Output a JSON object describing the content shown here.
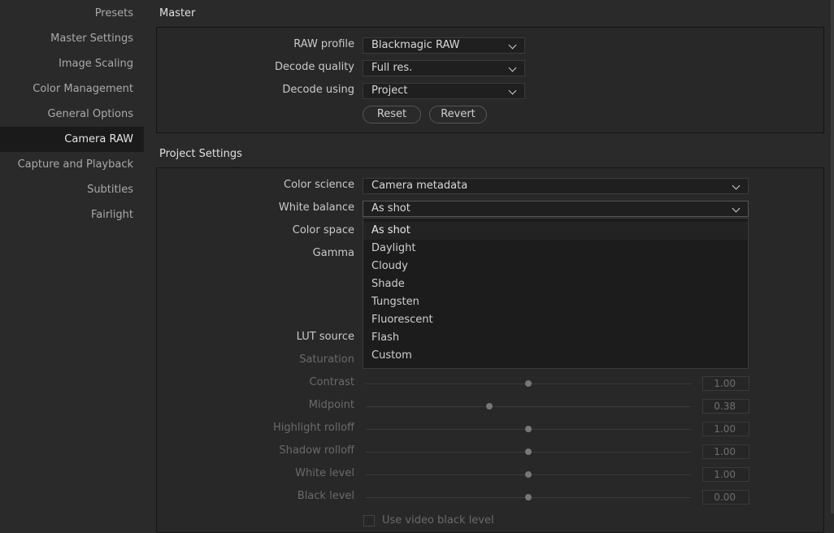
{
  "sidebar": {
    "items": [
      {
        "label": "Presets"
      },
      {
        "label": "Master Settings"
      },
      {
        "label": "Image Scaling"
      },
      {
        "label": "Color Management"
      },
      {
        "label": "General Options"
      },
      {
        "label": "Camera RAW",
        "active": true
      },
      {
        "label": "Capture and Playback"
      },
      {
        "label": "Subtitles"
      },
      {
        "label": "Fairlight"
      }
    ]
  },
  "master": {
    "title": "Master",
    "raw_profile_label": "RAW profile",
    "raw_profile_value": "Blackmagic RAW",
    "decode_quality_label": "Decode quality",
    "decode_quality_value": "Full res.",
    "decode_using_label": "Decode using",
    "decode_using_value": "Project",
    "reset_label": "Reset",
    "revert_label": "Revert"
  },
  "project": {
    "title": "Project Settings",
    "color_science_label": "Color science",
    "color_science_value": "Camera metadata",
    "white_balance_label": "White balance",
    "white_balance_value": "As shot",
    "color_space_label": "Color space",
    "gamma_label": "Gamma",
    "lut_source_label": "LUT source",
    "saturation_label": "Saturation",
    "sliders": [
      {
        "label": "Contrast",
        "value": "1.00",
        "level": 0.5
      },
      {
        "label": "Midpoint",
        "value": "0.38",
        "level": 0.38
      },
      {
        "label": "Highlight rolloff",
        "value": "1.00",
        "level": 0.5
      },
      {
        "label": "Shadow rolloff",
        "value": "1.00",
        "level": 0.5
      },
      {
        "label": "White level",
        "value": "1.00",
        "level": 0.5
      },
      {
        "label": "Black level",
        "value": "0.00",
        "level": 0.5
      }
    ],
    "video_black_label": "Use video black level"
  },
  "white_balance_dropdown": {
    "options": [
      "As shot",
      "Daylight",
      "Cloudy",
      "Shade",
      "Tungsten",
      "Fluorescent",
      "Flash",
      "Custom"
    ],
    "selected": "As shot"
  }
}
